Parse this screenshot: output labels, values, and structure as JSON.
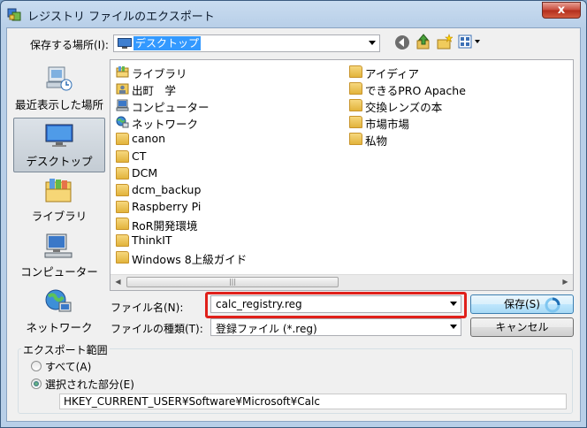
{
  "window": {
    "title": "レジストリ ファイルのエクスポート",
    "close_glyph": "x"
  },
  "toolbar": {
    "save_in_label": "保存する場所(I):",
    "save_in_value": "デスクトップ",
    "back_icon": "back-arrow-icon",
    "up_icon": "up-folder-icon",
    "new_folder_icon": "new-folder-icon",
    "view_icon": "view-menu-icon"
  },
  "places": [
    {
      "label": "最近表示した場所",
      "icon": "recent-places-icon"
    },
    {
      "label": "デスクトップ",
      "icon": "desktop-icon",
      "selected": true
    },
    {
      "label": "ライブラリ",
      "icon": "library-icon"
    },
    {
      "label": "コンピューター",
      "icon": "computer-icon"
    },
    {
      "label": "ネットワーク",
      "icon": "network-icon"
    }
  ],
  "files": {
    "column1": [
      {
        "name": "ライブラリ",
        "icon": "library-icon"
      },
      {
        "name": "出町　学",
        "icon": "user-folder-icon"
      },
      {
        "name": "コンピューター",
        "icon": "computer-icon"
      },
      {
        "name": "ネットワーク",
        "icon": "network-icon"
      },
      {
        "name": "canon",
        "icon": "folder-icon"
      },
      {
        "name": "CT",
        "icon": "folder-icon"
      },
      {
        "name": "DCM",
        "icon": "folder-icon"
      },
      {
        "name": "dcm_backup",
        "icon": "folder-icon"
      },
      {
        "name": "Raspberry Pi",
        "icon": "folder-icon"
      },
      {
        "name": "RoR開発環境",
        "icon": "folder-icon"
      },
      {
        "name": "ThinkIT",
        "icon": "folder-icon"
      },
      {
        "name": "Windows 8上級ガイド",
        "icon": "folder-icon"
      }
    ],
    "column2": [
      {
        "name": "アイディア",
        "icon": "folder-icon"
      },
      {
        "name": "できるPRO Apache",
        "icon": "folder-icon"
      },
      {
        "name": "交換レンズの本",
        "icon": "folder-icon"
      },
      {
        "name": "市場市場",
        "icon": "folder-icon"
      },
      {
        "name": "私物",
        "icon": "folder-icon"
      }
    ]
  },
  "form": {
    "filename_label": "ファイル名(N):",
    "filename_value": "calc_registry.reg",
    "filetype_label": "ファイルの種類(T):",
    "filetype_value": "登録ファイル (*.reg)",
    "save_button": "保存(S)",
    "cancel_button": "キャンセル"
  },
  "export_range": {
    "legend": "エクスポート範囲",
    "option_all": "すべて(A)",
    "option_selected": "選択された部分(E)",
    "selected_value": "HKEY_CURRENT_USER¥Software¥Microsoft¥Calc",
    "selected_option": "option_selected"
  },
  "colors": {
    "highlight": "#e0201a",
    "selection": "#3399ff"
  }
}
